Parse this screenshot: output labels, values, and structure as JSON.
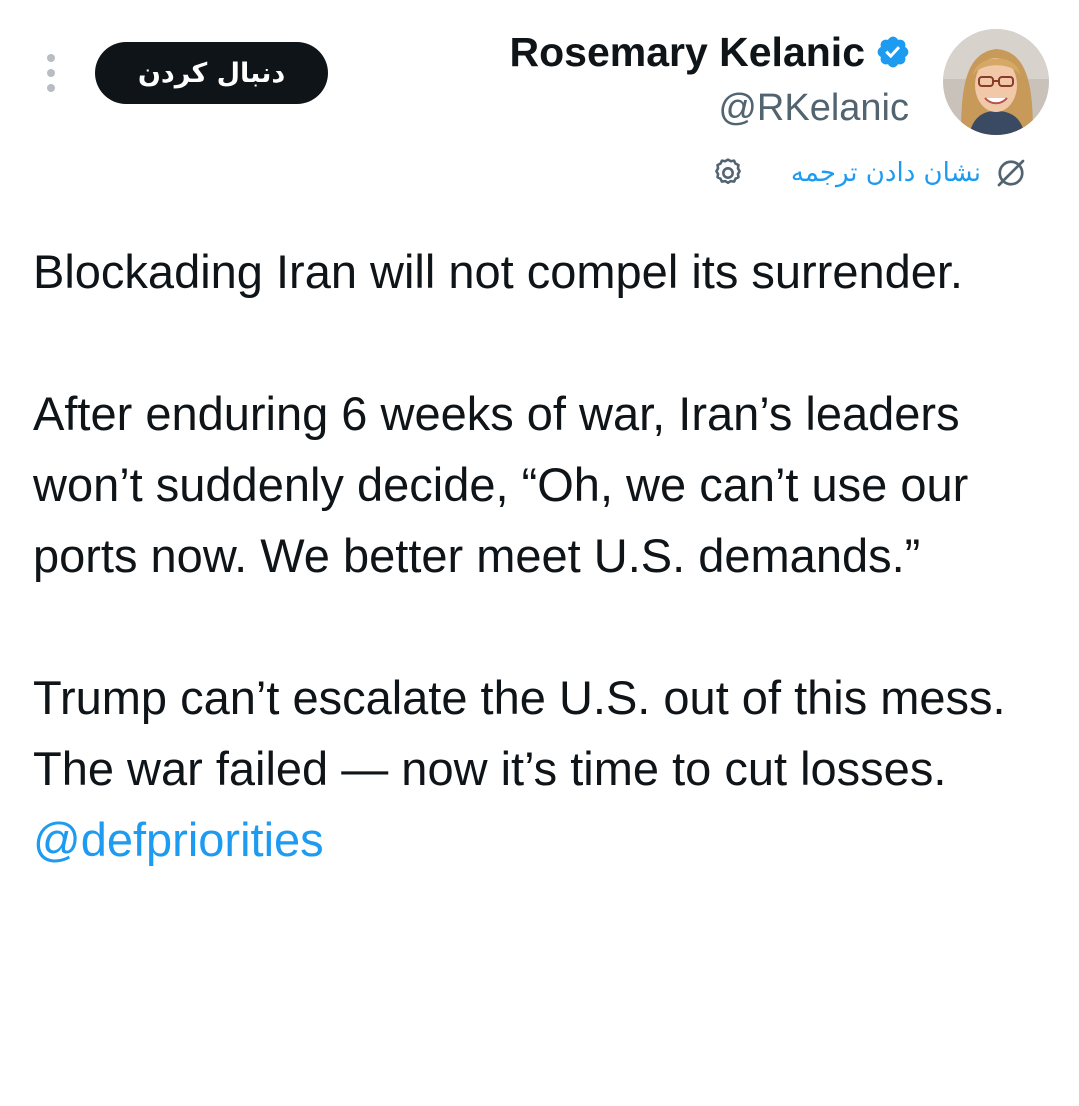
{
  "header": {
    "follow_label": "دنبال کردن",
    "display_name": "Rosemary Kelanic",
    "handle": "@RKelanic",
    "translate_label": "نشان دادن ترجمه"
  },
  "tweet": {
    "paragraph_1": "Blockading Iran will not compel its surrender.",
    "paragraph_2": "After enduring 6 weeks of war, Iran’s leaders won’t suddenly decide, “Oh, we can’t use our ports now. We better meet U.S. demands.”",
    "paragraph_3": "Trump can’t escalate the U.S. out of this mess. The war failed — now it’s time to cut losses.",
    "mention": "@defpriorities"
  },
  "icons": {
    "more": "more-vertical-icon",
    "verified": "verified-badge-icon",
    "settings": "gear-icon",
    "translate": "translate-icon"
  },
  "colors": {
    "accent": "#1d9bf0",
    "text": "#0f1419",
    "secondary": "#536471",
    "follow_button_bg": "#0f1419"
  }
}
